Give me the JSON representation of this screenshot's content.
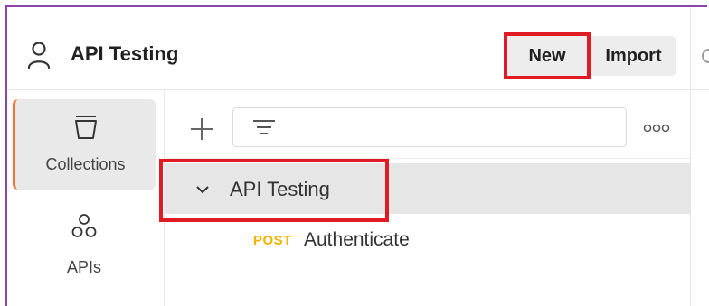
{
  "workspace": {
    "title": "API Testing",
    "icon": "user-icon"
  },
  "header": {
    "new_label": "New",
    "import_label": "Import"
  },
  "sidebar": {
    "items": [
      {
        "label": "Collections",
        "icon": "collections-icon",
        "active": true
      },
      {
        "label": "APIs",
        "icon": "apis-icon",
        "active": false
      }
    ]
  },
  "toolbar": {
    "add_icon": "plus-icon",
    "filter_icon": "filter-icon",
    "filter_value": "",
    "more_icon": "more-options-icon"
  },
  "tree": {
    "collection": {
      "name": "API Testing",
      "expanded": true,
      "requests": [
        {
          "method": "POST",
          "name": "Authenticate"
        }
      ]
    }
  },
  "colors": {
    "highlight_border": "#e01b24",
    "accent": "#ff6c37",
    "post_method": "#f2b200",
    "frame_border": "#8e44ad"
  }
}
